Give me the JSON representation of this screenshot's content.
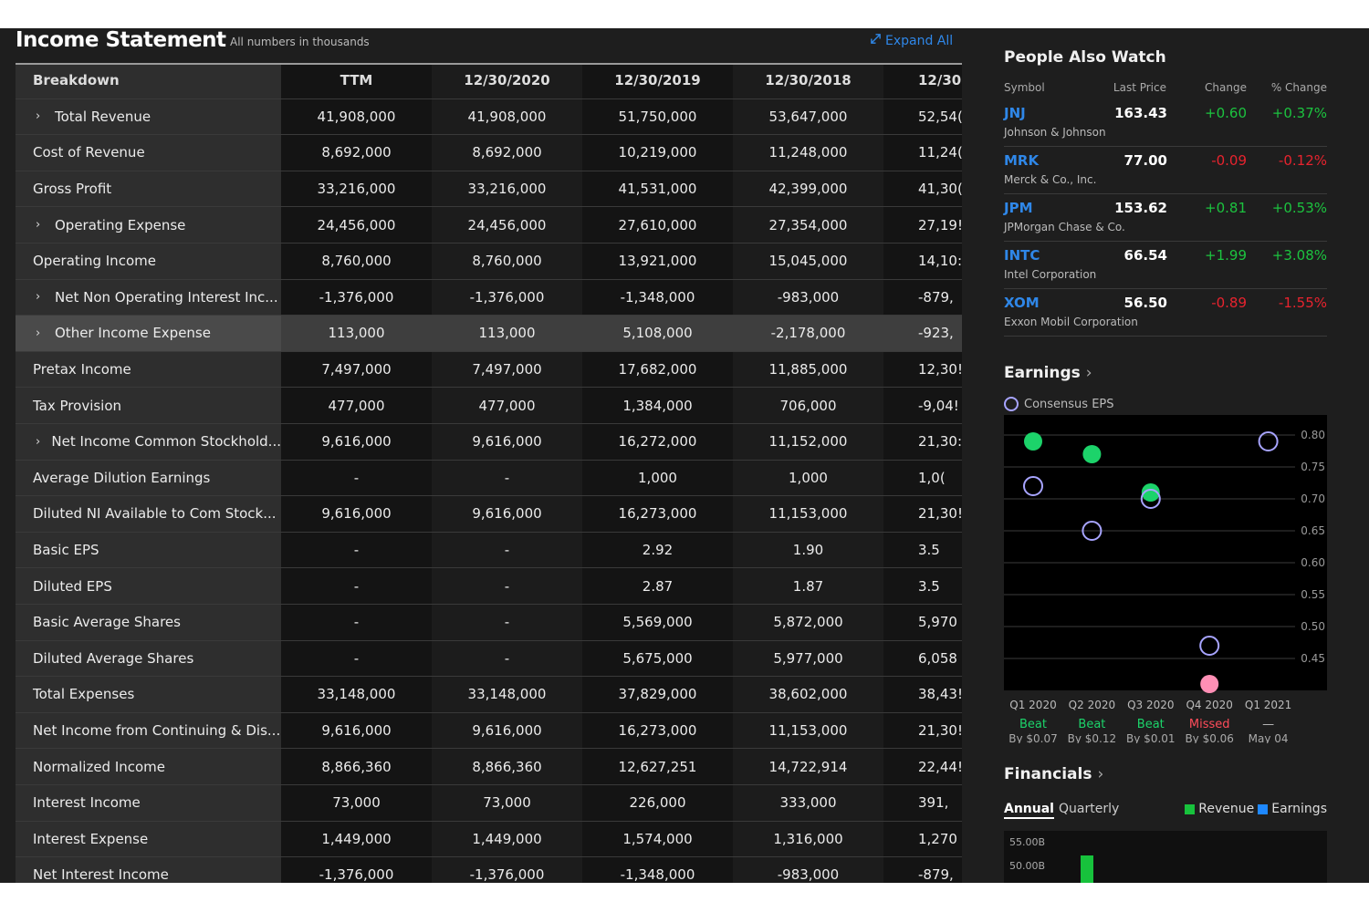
{
  "income_statement": {
    "title": "Income Statement",
    "note": "All numbers in thousands",
    "expand_label": "Expand All",
    "columns": [
      "Breakdown",
      "TTM",
      "12/30/2020",
      "12/30/2019",
      "12/30/2018",
      "12/30,"
    ],
    "rows": [
      {
        "label": "Total Revenue",
        "expandable": true,
        "values": [
          "41,908,000",
          "41,908,000",
          "51,750,000",
          "53,647,000",
          "52,54("
        ]
      },
      {
        "label": "Cost of Revenue",
        "expandable": false,
        "values": [
          "8,692,000",
          "8,692,000",
          "10,219,000",
          "11,248,000",
          "11,24("
        ]
      },
      {
        "label": "Gross Profit",
        "expandable": false,
        "values": [
          "33,216,000",
          "33,216,000",
          "41,531,000",
          "42,399,000",
          "41,30("
        ]
      },
      {
        "label": "Operating Expense",
        "expandable": true,
        "values": [
          "24,456,000",
          "24,456,000",
          "27,610,000",
          "27,354,000",
          "27,19!"
        ]
      },
      {
        "label": "Operating Income",
        "expandable": false,
        "values": [
          "8,760,000",
          "8,760,000",
          "13,921,000",
          "15,045,000",
          "14,10:"
        ]
      },
      {
        "label": "Net Non Operating Interest Inc...",
        "expandable": true,
        "values": [
          "-1,376,000",
          "-1,376,000",
          "-1,348,000",
          "-983,000",
          "-879,"
        ]
      },
      {
        "label": "Other Income Expense",
        "expandable": true,
        "highlighted": true,
        "values": [
          "113,000",
          "113,000",
          "5,108,000",
          "-2,178,000",
          "-923,"
        ]
      },
      {
        "label": "Pretax Income",
        "expandable": false,
        "values": [
          "7,497,000",
          "7,497,000",
          "17,682,000",
          "11,885,000",
          "12,30!"
        ]
      },
      {
        "label": "Tax Provision",
        "expandable": false,
        "values": [
          "477,000",
          "477,000",
          "1,384,000",
          "706,000",
          "-9,04!"
        ]
      },
      {
        "label": "Net Income Common Stockhold...",
        "expandable": true,
        "values": [
          "9,616,000",
          "9,616,000",
          "16,272,000",
          "11,152,000",
          "21,30:"
        ]
      },
      {
        "label": "Average Dilution Earnings",
        "expandable": false,
        "values": [
          "-",
          "-",
          "1,000",
          "1,000",
          "1,0("
        ]
      },
      {
        "label": "Diluted NI Available to Com Stock...",
        "expandable": false,
        "values": [
          "9,616,000",
          "9,616,000",
          "16,273,000",
          "11,153,000",
          "21,30!"
        ]
      },
      {
        "label": "Basic EPS",
        "expandable": false,
        "values": [
          "-",
          "-",
          "2.92",
          "1.90",
          "3.5"
        ]
      },
      {
        "label": "Diluted EPS",
        "expandable": false,
        "values": [
          "-",
          "-",
          "2.87",
          "1.87",
          "3.5"
        ]
      },
      {
        "label": "Basic Average Shares",
        "expandable": false,
        "values": [
          "-",
          "-",
          "5,569,000",
          "5,872,000",
          "5,970"
        ]
      },
      {
        "label": "Diluted Average Shares",
        "expandable": false,
        "values": [
          "-",
          "-",
          "5,675,000",
          "5,977,000",
          "6,058"
        ]
      },
      {
        "label": "Total Expenses",
        "expandable": false,
        "values": [
          "33,148,000",
          "33,148,000",
          "37,829,000",
          "38,602,000",
          "38,43!"
        ]
      },
      {
        "label": "Net Income from Continuing & Dis...",
        "expandable": false,
        "values": [
          "9,616,000",
          "9,616,000",
          "16,273,000",
          "11,153,000",
          "21,30!"
        ]
      },
      {
        "label": "Normalized Income",
        "expandable": false,
        "values": [
          "8,866,360",
          "8,866,360",
          "12,627,251",
          "14,722,914",
          "22,44!"
        ]
      },
      {
        "label": "Interest Income",
        "expandable": false,
        "values": [
          "73,000",
          "73,000",
          "226,000",
          "333,000",
          "391,"
        ]
      },
      {
        "label": "Interest Expense",
        "expandable": false,
        "values": [
          "1,449,000",
          "1,449,000",
          "1,574,000",
          "1,316,000",
          "1,270"
        ]
      },
      {
        "label": "Net Interest Income",
        "expandable": false,
        "values": [
          "-1,376,000",
          "-1,376,000",
          "-1,348,000",
          "-983,000",
          "-879,"
        ]
      }
    ]
  },
  "people_also_watch": {
    "title": "People Also Watch",
    "headers": {
      "symbol": "Symbol",
      "last_price": "Last Price",
      "change": "Change",
      "pct_change": "% Change"
    },
    "items": [
      {
        "symbol": "JNJ",
        "name": "Johnson & Johnson",
        "price": "163.43",
        "change": "+0.60",
        "pct": "+0.37%",
        "direction": "up"
      },
      {
        "symbol": "MRK",
        "name": "Merck & Co., Inc.",
        "price": "77.00",
        "change": "-0.09",
        "pct": "-0.12%",
        "direction": "down"
      },
      {
        "symbol": "JPM",
        "name": "JPMorgan Chase & Co.",
        "price": "153.62",
        "change": "+0.81",
        "pct": "+0.53%",
        "direction": "up"
      },
      {
        "symbol": "INTC",
        "name": "Intel Corporation",
        "price": "66.54",
        "change": "+1.99",
        "pct": "+3.08%",
        "direction": "up"
      },
      {
        "symbol": "XOM",
        "name": "Exxon Mobil Corporation",
        "price": "56.50",
        "change": "-0.89",
        "pct": "-1.55%",
        "direction": "down"
      }
    ]
  },
  "earnings": {
    "title": "Earnings",
    "legend": "Consensus EPS",
    "colors": {
      "estimate_ring": "#a7a4ff",
      "beat": "#1cd36a",
      "missed": "#ff8fb5",
      "grid": "#3c3c3c"
    }
  },
  "chart_data": {
    "type": "scatter",
    "title": "Earnings",
    "ylim": [
      0.4,
      0.82
    ],
    "y_ticks": [
      "0.80",
      "0.75",
      "0.70",
      "0.65",
      "0.60",
      "0.55",
      "0.50",
      "0.45"
    ],
    "categories": [
      "Q1 2020",
      "Q2 2020",
      "Q3 2020",
      "Q4 2020",
      "Q1 2021"
    ],
    "series": [
      {
        "name": "Consensus EPS",
        "values": [
          0.72,
          0.65,
          0.7,
          0.47,
          0.79
        ]
      },
      {
        "values": [
          0.79,
          0.77,
          0.71,
          0.41,
          null
        ]
      }
    ],
    "results": [
      "Beat",
      "Beat",
      "Beat",
      "Missed",
      "—"
    ],
    "result_details": [
      "By $0.07",
      "By $0.12",
      "By $0.01",
      "By $0.06",
      "May 04"
    ]
  },
  "financials": {
    "title": "Financials",
    "tabs": [
      "Annual",
      "Quarterly"
    ],
    "legend": [
      "Revenue",
      "Earnings"
    ],
    "colors": {
      "revenue": "#17c23c",
      "earnings": "#1e88ff"
    },
    "y_ticks": [
      "55.00B",
      "50.00B"
    ]
  }
}
